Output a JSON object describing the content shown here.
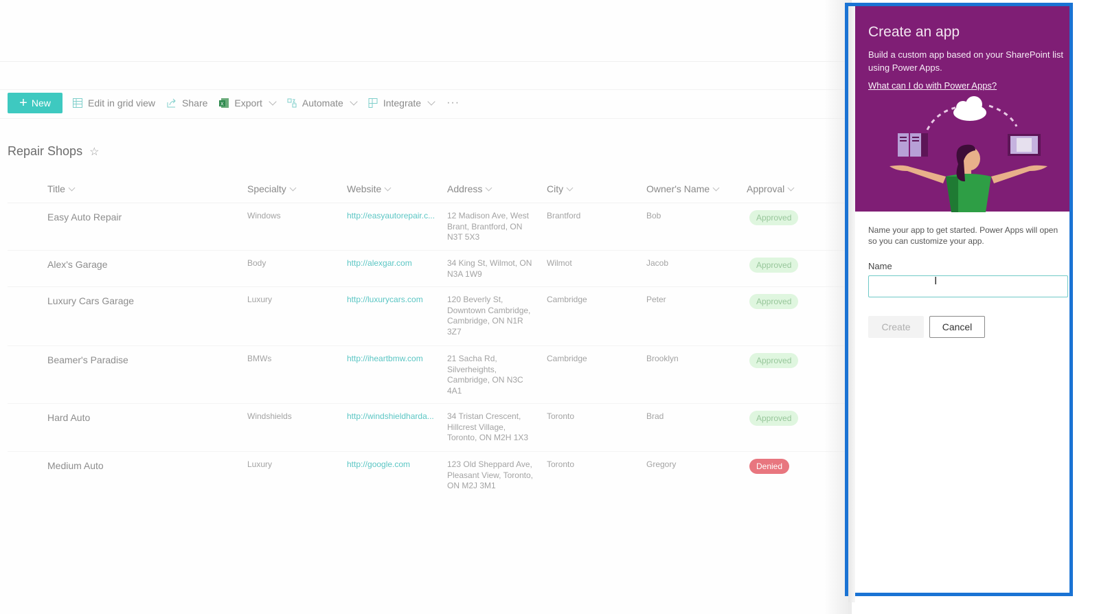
{
  "commandbar": {
    "new_label": "New",
    "items": [
      {
        "label": "Edit in grid view",
        "icon": "grid-view-icon",
        "dropdown": false
      },
      {
        "label": "Share",
        "icon": "share-icon",
        "dropdown": false
      },
      {
        "label": "Export",
        "icon": "excel-icon",
        "dropdown": true
      },
      {
        "label": "Automate",
        "icon": "automate-icon",
        "dropdown": true
      },
      {
        "label": "Integrate",
        "icon": "integrate-icon",
        "dropdown": true
      }
    ],
    "more_label": "···"
  },
  "list": {
    "title": "Repair Shops",
    "favorite_icon": "star-icon",
    "columns": [
      "Title",
      "Specialty",
      "Website",
      "Address",
      "City",
      "Owner's Name",
      "Approval"
    ],
    "rows": [
      {
        "title": "Easy Auto Repair",
        "specialty": "Windows",
        "website": "http://easyautorepair.c...",
        "address": "12 Madison Ave, West Brant, Brantford, ON N3T 5X3",
        "city": "Brantford",
        "owner": "Bob",
        "approval": "Approved"
      },
      {
        "title": "Alex's Garage",
        "specialty": "Body",
        "website": "http://alexgar.com",
        "address": "34 King St, Wilmot, ON N3A 1W9",
        "city": "Wilmot",
        "owner": "Jacob",
        "approval": "Approved"
      },
      {
        "title": "Luxury Cars Garage",
        "specialty": "Luxury",
        "website": "http://luxurycars.com",
        "address": "120 Beverly St, Downtown Cambridge, Cambridge, ON N1R 3Z7",
        "city": "Cambridge",
        "owner": "Peter",
        "approval": "Approved"
      },
      {
        "title": "Beamer's Paradise",
        "specialty": "BMWs",
        "website": "http://iheartbmw.com",
        "address": "21 Sacha Rd, Silverheights, Cambridge, ON N3C 4A1",
        "city": "Cambridge",
        "owner": "Brooklyn",
        "approval": "Approved"
      },
      {
        "title": "Hard Auto",
        "specialty": "Windshields",
        "website": "http://windshieldharda...",
        "address": "34 Tristan Crescent, Hillcrest Village, Toronto, ON M2H 1X3",
        "city": "Toronto",
        "owner": "Brad",
        "approval": "Approved"
      },
      {
        "title": "Medium Auto",
        "specialty": "Luxury",
        "website": "http://google.com",
        "address": "123 Old Sheppard Ave, Pleasant View, Toronto, ON M2J 3M1",
        "city": "Toronto",
        "owner": "Gregory",
        "approval": "Denied"
      }
    ]
  },
  "panel": {
    "title": "Create an app",
    "description": "Build a custom app based on your SharePoint list using Power Apps.",
    "link": "What can I do with Power Apps?",
    "body_text": "Name your app to get started. Power Apps will open so you can customize your app.",
    "name_label": "Name",
    "name_value": "",
    "name_placeholder": "",
    "create_label": "Create",
    "cancel_label": "Cancel"
  },
  "colors": {
    "accent_teal": "#3ec9c0",
    "panel_purple": "#7f1e75",
    "highlight_blue": "#1a73d4",
    "approved_bg": "#dff6df",
    "denied_bg": "#e8767f"
  }
}
